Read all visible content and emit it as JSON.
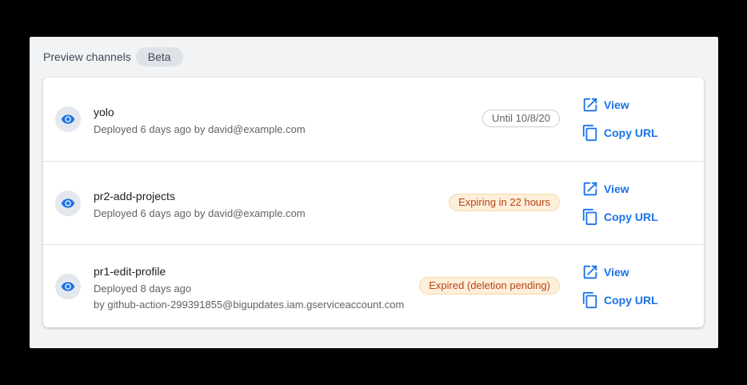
{
  "header": {
    "title": "Preview channels",
    "badge": "Beta"
  },
  "colors": {
    "accent": "#1a73e8",
    "warning_text": "#b8431a",
    "warning_bg": "#fdefd9"
  },
  "channels": [
    {
      "name": "yolo",
      "lines": [
        "Deployed 6 days ago by david@example.com"
      ],
      "status": "Until 10/8/20",
      "status_kind": "neutral",
      "view_label": "View",
      "copy_label": "Copy URL"
    },
    {
      "name": "pr2-add-projects",
      "lines": [
        "Deployed 6 days ago by david@example.com"
      ],
      "status": "Expiring in 22 hours",
      "status_kind": "warning",
      "view_label": "View",
      "copy_label": "Copy URL"
    },
    {
      "name": "pr1-edit-profile",
      "lines": [
        "Deployed 8 days ago",
        "by github-action-299391855@bigupdates.iam.gserviceaccount.com"
      ],
      "status": "Expired (deletion pending)",
      "status_kind": "warning",
      "view_label": "View",
      "copy_label": "Copy URL"
    }
  ]
}
